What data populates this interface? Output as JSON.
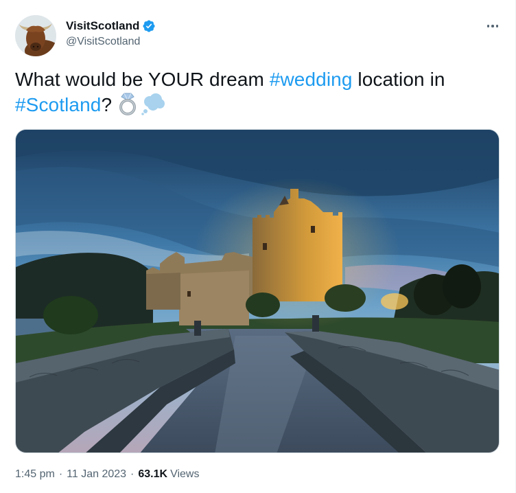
{
  "author": {
    "display_name": "VisitScotland",
    "handle": "@VisitScotland",
    "verified": true,
    "avatar_icon": "highland-cow-avatar"
  },
  "tweet": {
    "text_before": "What would be YOUR dream ",
    "hashtag_1": "#wedding",
    "text_middle": " location in ",
    "hashtag_2": "#Scotland",
    "text_after": "?",
    "emojis": [
      "ring-emoji",
      "thought-balloon-emoji"
    ],
    "media": {
      "alt_subject": "castle-at-dusk-photo"
    }
  },
  "meta": {
    "time": "1:45 pm",
    "separator": "·",
    "date": "11 Jan 2023",
    "views_count": "63.1K",
    "views_label": "Views"
  },
  "colors": {
    "accent": "#1d9bf0",
    "text_primary": "#0f1419",
    "text_secondary": "#536471",
    "border": "#cfd9de"
  },
  "menu": {
    "more_icon": "more-options-icon"
  }
}
